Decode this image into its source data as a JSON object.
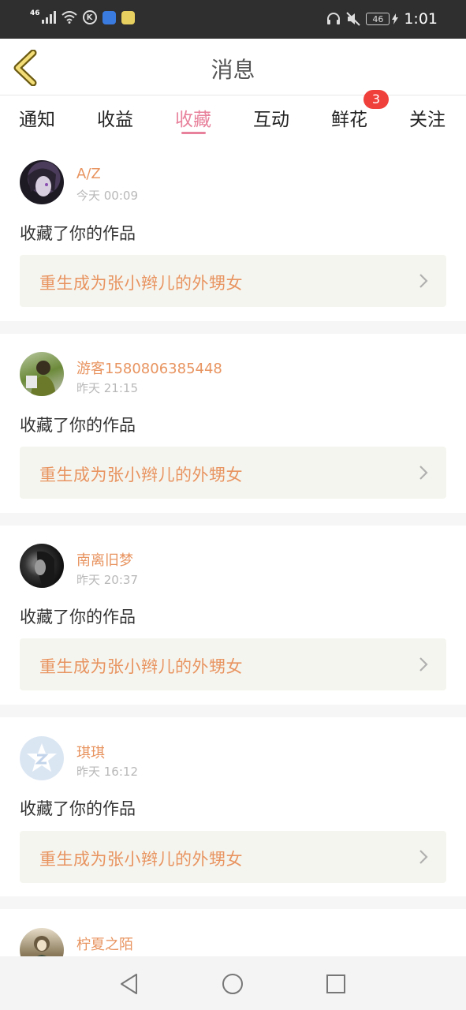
{
  "status": {
    "network_label": "46",
    "battery": "46",
    "time": "1:01",
    "k_label": "K"
  },
  "header": {
    "title": "消息",
    "back_icon": "chevron-left-icon"
  },
  "tabs": [
    {
      "label": "通知"
    },
    {
      "label": "收益"
    },
    {
      "label": "收藏",
      "active": true
    },
    {
      "label": "互动"
    },
    {
      "label": "鲜花",
      "badge": "3"
    },
    {
      "label": "关注"
    }
  ],
  "messages": [
    {
      "user": "A/Z",
      "time": "今天 00:09",
      "action": "收藏了你的作品",
      "work": "重生成为张小辫儿的外甥女"
    },
    {
      "user": "游客1580806385448",
      "time": "昨天 21:15",
      "action": "收藏了你的作品",
      "work": "重生成为张小辫儿的外甥女"
    },
    {
      "user": "南离旧梦",
      "time": "昨天 20:37",
      "action": "收藏了你的作品",
      "work": "重生成为张小辫儿的外甥女"
    },
    {
      "user": "琪琪",
      "time": "昨天 16:12",
      "action": "收藏了你的作品",
      "work": "重生成为张小辫儿的外甥女"
    },
    {
      "user": "柠夏之陌"
    }
  ],
  "colors": {
    "accent": "#e8829c",
    "username": "#e89460",
    "badge": "#f0403c"
  }
}
